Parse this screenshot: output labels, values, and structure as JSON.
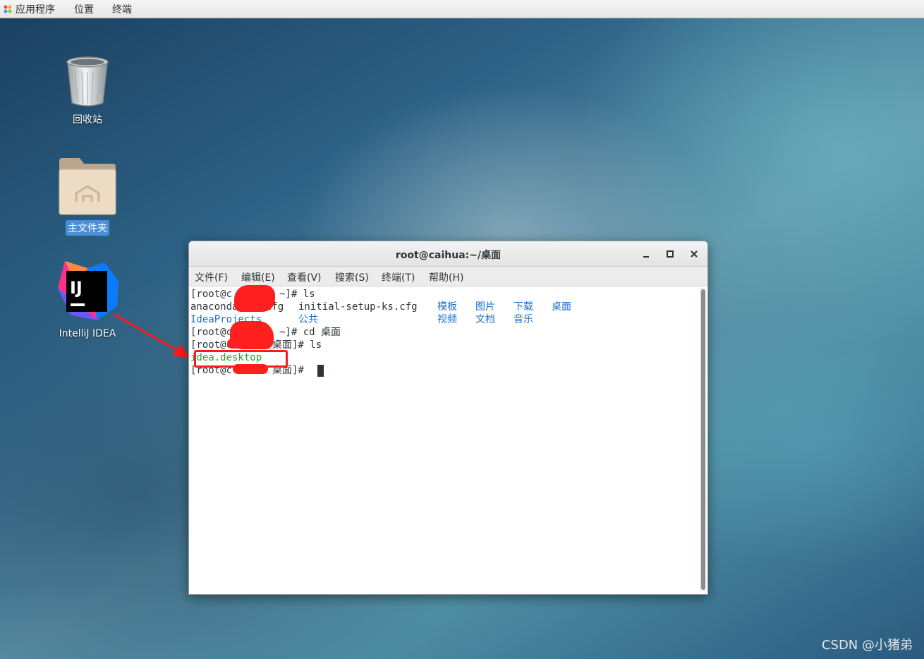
{
  "topbar": {
    "applications": "应用程序",
    "places": "位置",
    "terminal": "终端"
  },
  "desktop": {
    "icons": [
      {
        "label": "回收站",
        "icon": "trash-icon"
      },
      {
        "label": "主文件夹",
        "icon": "home-folder-icon",
        "selected": true
      },
      {
        "label": "IntelliJ IDEA",
        "icon": "intellij-idea-icon"
      }
    ]
  },
  "terminal": {
    "title": "root@caihua:~/桌面",
    "menu": [
      "文件(F)",
      "编辑(E)",
      "查看(V)",
      "搜索(S)",
      "终端(T)",
      "帮助(H)"
    ],
    "lines": {
      "l1_prompt_a": "[root@c",
      "l1_prompt_b": "~]# ls",
      "l2_a": "anaconda",
      "l2_b": "s.cfg",
      "l2_c": "initial-setup-ks.cfg",
      "dir_templates": "模板",
      "dir_pictures": "图片",
      "dir_downloads": "下载",
      "dir_desktop": "桌面",
      "dir_ideaprojects": "IdeaProjects",
      "dir_public": "公共",
      "dir_videos": "视频",
      "dir_documents": "文档",
      "dir_music": "音乐",
      "l4_prompt_a": "[root@c",
      "l4_prompt_b": "~]# cd 桌面",
      "l5_prompt_a": "[root@c",
      "l5_prompt_b": "桌面]# ls",
      "file_idea_desktop": "idea.desktop",
      "l7_prompt_a": "[root@c",
      "l7_prompt_b": "桌面]#"
    }
  },
  "watermark": "CSDN @小猪弟",
  "colors": {
    "directory": "#1a6fd1",
    "executable": "#2aa52a",
    "annotation": "#ff1a1a",
    "selection": "#4a90d9"
  }
}
